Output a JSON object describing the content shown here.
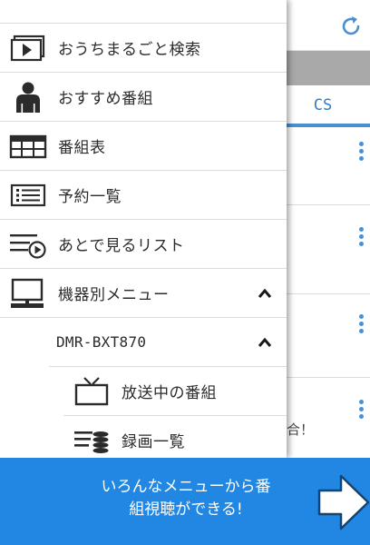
{
  "background": {
    "tab_cs_label": "CS",
    "snippet_text": "合！"
  },
  "drawer": {
    "items": [
      {
        "label": "おうちまるごと検索",
        "icon": "tv-play-icon"
      },
      {
        "label": "おすすめ番組",
        "icon": "person-icon"
      },
      {
        "label": "番組表",
        "icon": "grid-table-icon"
      },
      {
        "label": "予約一覧",
        "icon": "list-icon"
      },
      {
        "label": "あとで見るリスト",
        "icon": "watch-later-list-icon"
      },
      {
        "label": "機器別メニュー",
        "icon": "monitor-icon",
        "expanded": true
      }
    ],
    "device": {
      "label": "DMR-BXT870",
      "expanded": true
    },
    "device_items": [
      {
        "label": "放送中の番組",
        "icon": "tv-antenna-icon"
      },
      {
        "label": "録画一覧",
        "icon": "recordings-disc-icon"
      }
    ]
  },
  "banner": {
    "line1": "いろんなメニューから番",
    "line2": "組視聴ができる!"
  },
  "colors": {
    "accent": "#4a8fd3",
    "banner_bg": "#2187e2",
    "icon_dark": "#2b2b2b",
    "divider": "#dcdcdc",
    "gray_band": "#a9a9a9"
  }
}
